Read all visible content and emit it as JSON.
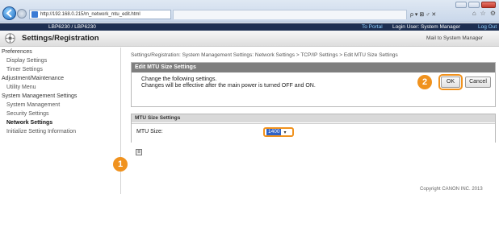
{
  "browser": {
    "url": "http://192.168.0.215/m_network_mtu_edit.html",
    "search_placeholder": "ρ▾",
    "search_controls": "ρ ▾ ⊠ ♂ ✕"
  },
  "banner": {
    "model": "LBP6230 / LBP6230",
    "portal_link": "To Portal",
    "login_text": "Login User: System Manager",
    "logout_link": "Log Out"
  },
  "header": {
    "title": "Settings/Registration",
    "mail_link": "Mail to System Manager"
  },
  "sidebar": {
    "sections": [
      {
        "title": "Preferences",
        "items": [
          "Display Settings",
          "Timer Settings"
        ]
      },
      {
        "title": "Adjustment/Maintenance",
        "items": [
          "Utility Menu"
        ]
      },
      {
        "title": "System Management Settings",
        "items": [
          "System Management",
          "Security Settings",
          "Network Settings",
          "Initialize Setting Information"
        ]
      }
    ]
  },
  "main": {
    "breadcrumb": "Settings/Registration: System Management Settings: Network Settings > TCP/IP Settings > Edit MTU Size Settings",
    "edit_title": "Edit MTU Size Settings",
    "instruction_1": "Change the following settings.",
    "instruction_2": "Changes will be effective after the main power is turned OFF and ON.",
    "ok_label": "OK",
    "cancel_label": "Cancel",
    "mtu_section_title": "MTU Size Settings",
    "mtu_label": "MTU Size:",
    "mtu_value": "1400",
    "copyright": "Copyright CANON INC. 2013"
  },
  "markers": {
    "first": "1",
    "second": "2"
  },
  "colors": {
    "banner": "#1d2f52",
    "accent_orange": "#f0921e",
    "panel_header": "#7e7e7e",
    "select_highlight": "#2f63c7"
  }
}
